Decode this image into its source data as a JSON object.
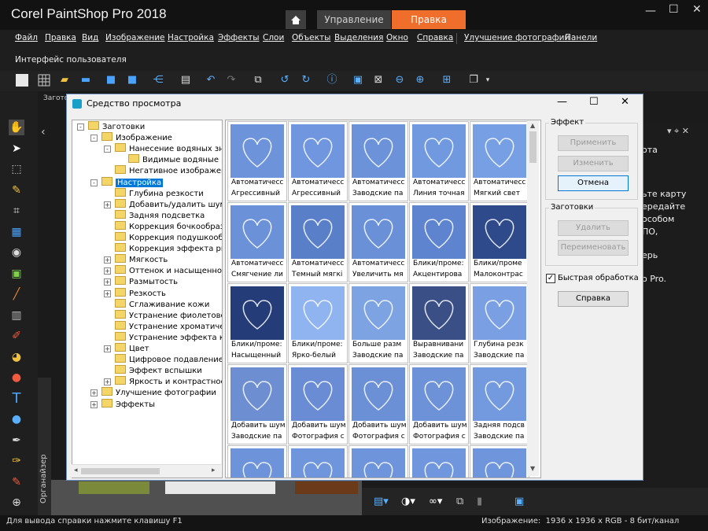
{
  "app": {
    "title": "Corel PaintShop Pro 2018",
    "tabs": [
      "Управление",
      "Правка"
    ]
  },
  "menu": {
    "items": [
      "Файл",
      "Правка",
      "Вид",
      "Изображение",
      "Настройка",
      "Эффекты",
      "Слои",
      "Объекты",
      "Выделения",
      "Окно",
      "Справка",
      "Улучшение фотографии",
      "Панели"
    ],
    "second_row": "Интерфейс пользователя"
  },
  "panel_labels": {
    "presets_short": "Заготов",
    "organizer": "Органайзер"
  },
  "right_panel_text": [
    "ота",
    "ьте карту",
    "ередайте",
    "особом",
    "ПО,",
    "ерь",
    "o Pro."
  ],
  "dialog": {
    "title": "Средство просмотра",
    "effect_group": "Эффект",
    "presets_group": "Заготовки",
    "buttons": {
      "apply": "Применить",
      "modify": "Изменить",
      "cancel": "Отмена",
      "delete": "Удалить",
      "rename": "Переименовать",
      "help": "Справка"
    },
    "quick_label": "Быстрая обработка",
    "quick_checked": true,
    "tree": [
      {
        "label": "Заготовки",
        "level": 0,
        "exp": "-"
      },
      {
        "label": "Изображение",
        "level": 1,
        "exp": "-"
      },
      {
        "label": "Нанесение водяных знак",
        "level": 2,
        "exp": "-"
      },
      {
        "label": "Видимые водяные зн",
        "level": 3,
        "exp": ""
      },
      {
        "label": "Негативное изображени",
        "level": 2,
        "exp": ""
      },
      {
        "label": "Настройка",
        "level": 1,
        "exp": "-",
        "selected": true
      },
      {
        "label": "Глубина резкости",
        "level": 2,
        "exp": ""
      },
      {
        "label": "Добавить/удалить шум",
        "level": 2,
        "exp": "+"
      },
      {
        "label": "Задняя подсветка",
        "level": 2,
        "exp": ""
      },
      {
        "label": "Коррекция бочкообразн",
        "level": 2,
        "exp": ""
      },
      {
        "label": "Коррекция подушкообра",
        "level": 2,
        "exp": ""
      },
      {
        "label": "Коррекция эффекта рыб",
        "level": 2,
        "exp": ""
      },
      {
        "label": "Мягкость",
        "level": 2,
        "exp": "+"
      },
      {
        "label": "Оттенок и насыщенност",
        "level": 2,
        "exp": "+"
      },
      {
        "label": "Размытость",
        "level": 2,
        "exp": "+"
      },
      {
        "label": "Резкость",
        "level": 2,
        "exp": "+"
      },
      {
        "label": "Сглаживание кожи",
        "level": 2,
        "exp": ""
      },
      {
        "label": "Устранение фиолетовой",
        "level": 2,
        "exp": ""
      },
      {
        "label": "Устранение хроматическ",
        "level": 2,
        "exp": ""
      },
      {
        "label": "Устранение эффекта кра",
        "level": 2,
        "exp": ""
      },
      {
        "label": "Цвет",
        "level": 2,
        "exp": "+"
      },
      {
        "label": "Цифровое подавление ш",
        "level": 2,
        "exp": ""
      },
      {
        "label": "Эффект вспышки",
        "level": 2,
        "exp": ""
      },
      {
        "label": "Яркость и контрастност",
        "level": 2,
        "exp": "+"
      },
      {
        "label": "Улучшение фотографии",
        "level": 1,
        "exp": "+"
      },
      {
        "label": "Эффекты",
        "level": 1,
        "exp": "+"
      }
    ],
    "thumbs": [
      {
        "c1": "Автоматичесс",
        "c2": "Агрессивный",
        "col": "#6d93db"
      },
      {
        "c1": "Автоматичесс",
        "c2": "Агрессивный",
        "col": "#6f96df"
      },
      {
        "c1": "Автоматичесс",
        "c2": "Заводские па",
        "col": "#6c92da"
      },
      {
        "c1": "Автоматичесс",
        "c2": "Линия точная",
        "col": "#7199e0"
      },
      {
        "c1": "Автоматичесс",
        "c2": "Мягкий свет",
        "col": "#77a0e4"
      },
      {
        "c1": "Автоматичесс",
        "c2": "Смягчение ли",
        "col": "#6b91d8"
      },
      {
        "c1": "Автоматичесс",
        "c2": "Темный мягкі",
        "col": "#5a7fc9"
      },
      {
        "c1": "Автоматичесс",
        "c2": "Увеличить мя",
        "col": "#6a90d8"
      },
      {
        "c1": "Блики/проме:",
        "c2": "Акцентирова",
        "col": "#5e84cf"
      },
      {
        "c1": "Блики/проме",
        "c2": "Малоконтрас",
        "col": "#2e4a8a"
      },
      {
        "c1": "Блики/проме:",
        "c2": "Насыщенный",
        "col": "#243c78"
      },
      {
        "c1": "Блики/проме:",
        "c2": "Ярко-белый",
        "col": "#8fb4ef"
      },
      {
        "c1": "Больше разм",
        "c2": "Заводские па",
        "col": "#7ea3e2"
      },
      {
        "c1": "Выравнивани",
        "c2": "Заводские па",
        "col": "#3a4f86"
      },
      {
        "c1": "Глубина резк",
        "c2": "Заводские па",
        "col": "#7aa0e3"
      },
      {
        "c1": "Добавить шум",
        "c2": "Заводские па",
        "col": "#6d8ed0"
      },
      {
        "c1": "Добавить шум",
        "c2": "Фотография с",
        "col": "#6a8cd4"
      },
      {
        "c1": "Добавить шум",
        "c2": "Фотография с",
        "col": "#6c90d6"
      },
      {
        "c1": "Добавить шум",
        "c2": "Фотография с",
        "col": "#6d92d8"
      },
      {
        "c1": "Задняя подсв",
        "c2": "Заводские па",
        "col": "#7399de"
      },
      {
        "c1": "",
        "c2": "",
        "col": "#6d93db"
      },
      {
        "c1": "",
        "c2": "",
        "col": "#6f95dc"
      },
      {
        "c1": "",
        "c2": "",
        "col": "#6e94db"
      },
      {
        "c1": "",
        "c2": "",
        "col": "#7097dd"
      },
      {
        "c1": "",
        "c2": "",
        "col": "#6f95dc"
      }
    ]
  },
  "status": {
    "left": "Для вывода справки нажмите клавишу F1",
    "right": "Изображение:  1936 x 1936 x RGB - 8 бит/канал"
  }
}
